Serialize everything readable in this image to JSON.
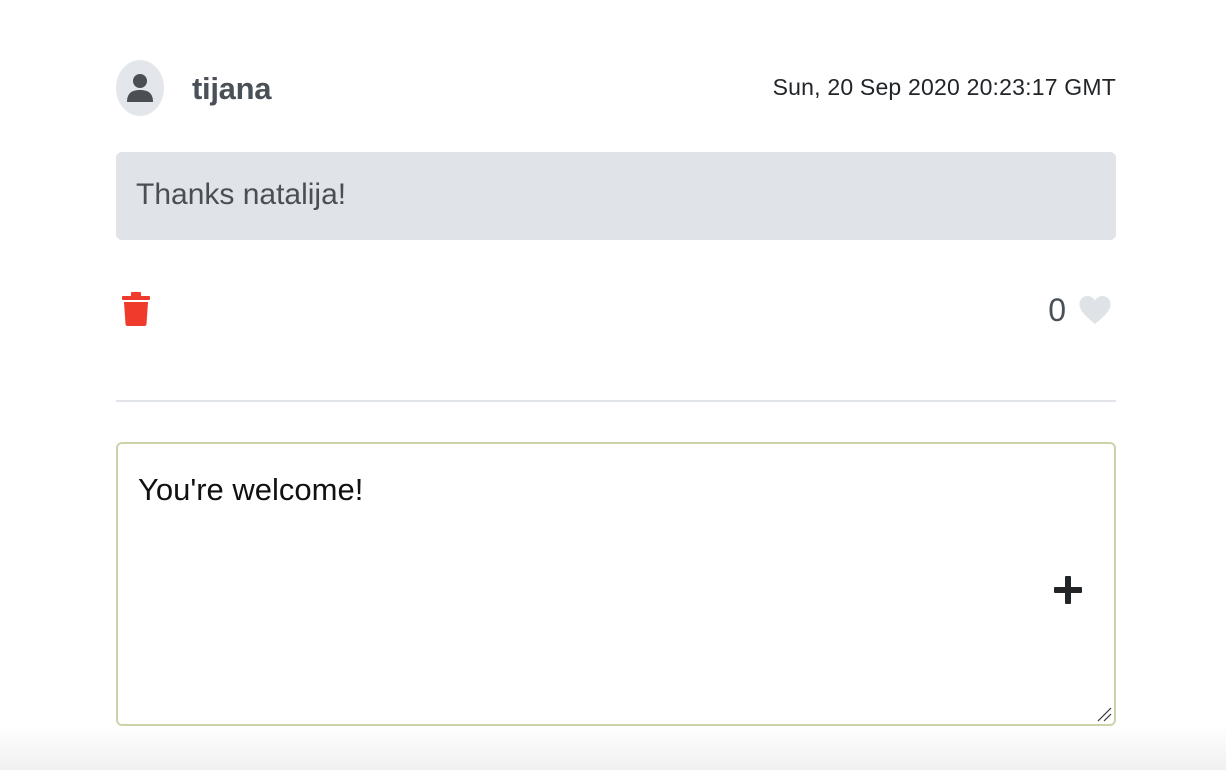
{
  "comment": {
    "author": "tijana",
    "timestamp": "Sun, 20 Sep 2020 20:23:17 GMT",
    "message": "Thanks natalija!",
    "likes": "0"
  },
  "icons": {
    "avatar": "user-icon",
    "delete": "trash-icon",
    "like": "heart-icon",
    "add": "plus-icon"
  },
  "colors": {
    "delete": "#f03a2c",
    "heart": "#dfe2e6",
    "message_bg": "#e0e3e8",
    "reply_border": "#ccd3a8"
  },
  "reply": {
    "value": "You're welcome!"
  }
}
